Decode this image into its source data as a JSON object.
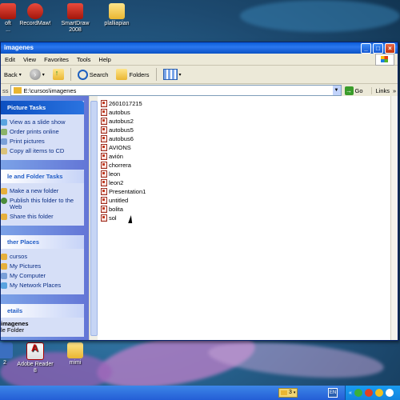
{
  "desktop": {
    "top_icons": [
      {
        "label": "oft\n..."
      },
      {
        "label": "RecordMaw!"
      },
      {
        "label": "SmartDraw\n2008"
      },
      {
        "label": "plalliapian"
      }
    ],
    "bottom_icons": [
      {
        "label": "2"
      },
      {
        "label": "Adobe Reader\n8"
      },
      {
        "label": "mimi"
      }
    ]
  },
  "window": {
    "title": "imagenes",
    "menu": [
      "Edit",
      "View",
      "Favorites",
      "Tools",
      "Help"
    ],
    "toolbar": {
      "back": "Back",
      "search": "Search",
      "folders": "Folders"
    },
    "address": {
      "label": "ss",
      "value": "E:\\cursos\\imagenes",
      "go": "Go",
      "links": "Links"
    }
  },
  "sidebar": {
    "picture_tasks": {
      "title": "Picture Tasks",
      "items": [
        "View as a slide show",
        "Order prints online",
        "Print pictures",
        "Copy all items to CD"
      ]
    },
    "file_folder_tasks": {
      "title": "le and Folder Tasks",
      "items": [
        "Make a new folder",
        "Publish this folder to the Web",
        "Share this folder"
      ]
    },
    "other_places": {
      "title": "ther Places",
      "items": [
        "cursos",
        "My Pictures",
        "My Computer",
        "My Network Places"
      ]
    },
    "details": {
      "title": "etails",
      "name": "imagenes",
      "type": "le Folder"
    }
  },
  "files": [
    "2601017215",
    "autobus",
    "autobus2",
    "autobus5",
    "autobus6",
    "AVIONS",
    "avión",
    "chorrera",
    "leon",
    "leon2",
    "Presentation1",
    "untitled",
    "bolita",
    "sol"
  ],
  "taskbar": {
    "tray_count": "3"
  }
}
